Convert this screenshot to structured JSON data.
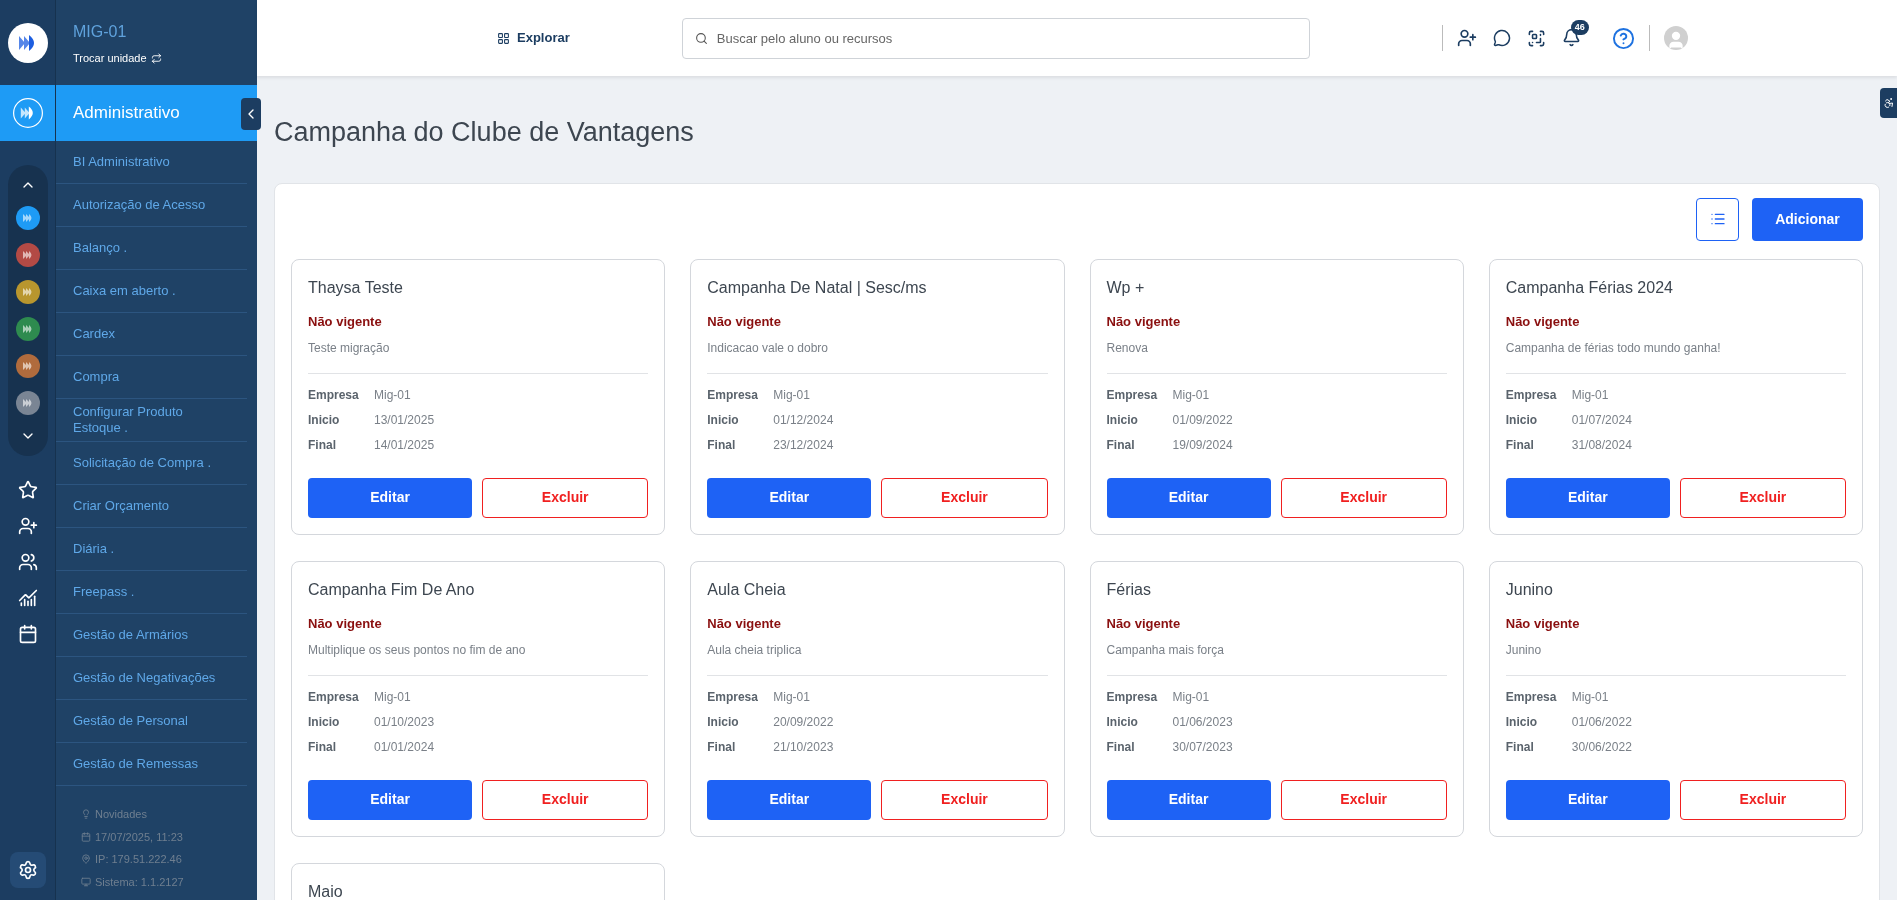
{
  "unit": {
    "name": "MIG-01",
    "switch_label": "Trocar unidade"
  },
  "module": {
    "title": "Administrativo"
  },
  "unit_logos": [
    {
      "color": "#1e9bf5"
    },
    {
      "color": "#b34a45"
    },
    {
      "color": "#b8962e"
    },
    {
      "color": "#2e8b4f"
    },
    {
      "color": "#b06b3d"
    },
    {
      "color": "#7a8594"
    }
  ],
  "menu_items": [
    "BI Administrativo",
    "Autorização de Acesso",
    "Balanço .",
    "Caixa em aberto .",
    "Cardex",
    "Compra",
    "Configurar Produto Estoque .",
    "Solicitação de Compra .",
    "Criar Orçamento",
    "Diária .",
    "Freepass .",
    "Gestão de Armários",
    "Gestão de Negativações",
    "Gestão de Personal",
    "Gestão de Remessas"
  ],
  "footer_info": [
    {
      "kind": "news",
      "text": "Novidades"
    },
    {
      "kind": "date",
      "text": "17/07/2025, 11:23"
    },
    {
      "kind": "ip",
      "text": "IP: 179.51.222.46"
    },
    {
      "kind": "system",
      "text": "Sistema: 1.1.2127"
    }
  ],
  "header": {
    "explore": "Explorar",
    "search_placeholder": "Buscar pelo aluno ou recursos",
    "notifications": "46"
  },
  "page_title": "Campanha do Clube de Vantagens",
  "add_button": "Adicionar",
  "campaigns": [
    {
      "title": "Thaysa Teste",
      "status": "Não vigente",
      "description": "Teste migração",
      "fields": [
        {
          "label": "Empresa",
          "value": "Mig-01"
        },
        {
          "label": "Inicio",
          "value": "13/01/2025"
        },
        {
          "label": "Final",
          "value": "14/01/2025"
        }
      ],
      "edit": "Editar",
      "delete": "Excluir"
    },
    {
      "title": "Campanha De Natal | Sesc/ms",
      "status": "Não vigente",
      "description": "Indicacao vale o dobro",
      "fields": [
        {
          "label": "Empresa",
          "value": "Mig-01"
        },
        {
          "label": "Inicio",
          "value": "01/12/2024"
        },
        {
          "label": "Final",
          "value": "23/12/2024"
        }
      ],
      "edit": "Editar",
      "delete": "Excluir"
    },
    {
      "title": "Wp +",
      "status": "Não vigente",
      "description": "Renova",
      "fields": [
        {
          "label": "Empresa",
          "value": "Mig-01"
        },
        {
          "label": "Inicio",
          "value": "01/09/2022"
        },
        {
          "label": "Final",
          "value": "19/09/2024"
        }
      ],
      "edit": "Editar",
      "delete": "Excluir"
    },
    {
      "title": "Campanha Férias 2024",
      "status": "Não vigente",
      "description": "Campanha de férias todo mundo ganha!",
      "fields": [
        {
          "label": "Empresa",
          "value": "Mig-01"
        },
        {
          "label": "Inicio",
          "value": "01/07/2024"
        },
        {
          "label": "Final",
          "value": "31/08/2024"
        }
      ],
      "edit": "Editar",
      "delete": "Excluir"
    },
    {
      "title": "Campanha Fim De Ano",
      "status": "Não vigente",
      "description": "Multiplique os seus pontos no fim de ano",
      "fields": [
        {
          "label": "Empresa",
          "value": "Mig-01"
        },
        {
          "label": "Inicio",
          "value": "01/10/2023"
        },
        {
          "label": "Final",
          "value": "01/01/2024"
        }
      ],
      "edit": "Editar",
      "delete": "Excluir"
    },
    {
      "title": "Aula Cheia",
      "status": "Não vigente",
      "description": "Aula cheia triplica",
      "fields": [
        {
          "label": "Empresa",
          "value": "Mig-01"
        },
        {
          "label": "Inicio",
          "value": "20/09/2022"
        },
        {
          "label": "Final",
          "value": "21/10/2023"
        }
      ],
      "edit": "Editar",
      "delete": "Excluir"
    },
    {
      "title": "Férias",
      "status": "Não vigente",
      "description": "Campanha mais força",
      "fields": [
        {
          "label": "Empresa",
          "value": "Mig-01"
        },
        {
          "label": "Inicio",
          "value": "01/06/2023"
        },
        {
          "label": "Final",
          "value": "30/07/2023"
        }
      ],
      "edit": "Editar",
      "delete": "Excluir"
    },
    {
      "title": "Junino",
      "status": "Não vigente",
      "description": "Junino",
      "fields": [
        {
          "label": "Empresa",
          "value": "Mig-01"
        },
        {
          "label": "Inicio",
          "value": "01/06/2022"
        },
        {
          "label": "Final",
          "value": "30/06/2022"
        }
      ],
      "edit": "Editar",
      "delete": "Excluir"
    },
    {
      "title": "Maio"
    }
  ]
}
